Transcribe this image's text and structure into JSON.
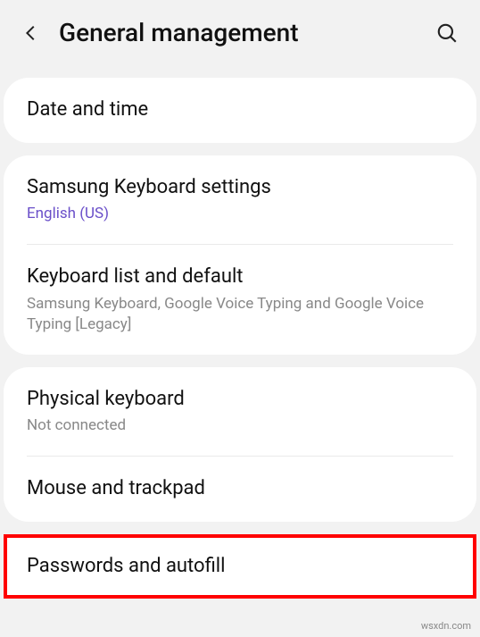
{
  "header": {
    "title": "General management"
  },
  "groups": [
    {
      "items": [
        {
          "title": "Date and time"
        }
      ]
    },
    {
      "items": [
        {
          "title": "Samsung Keyboard settings",
          "sub": "English (US)",
          "subLink": true
        },
        {
          "title": "Keyboard list and default",
          "sub": "Samsung Keyboard, Google Voice Typing and Google Voice Typing [Legacy]"
        }
      ]
    },
    {
      "items": [
        {
          "title": "Physical keyboard",
          "sub": "Not connected"
        },
        {
          "title": "Mouse and trackpad"
        }
      ]
    }
  ],
  "highlighted": {
    "title": "Passwords and autofill"
  },
  "watermark": "wsxdn.com"
}
